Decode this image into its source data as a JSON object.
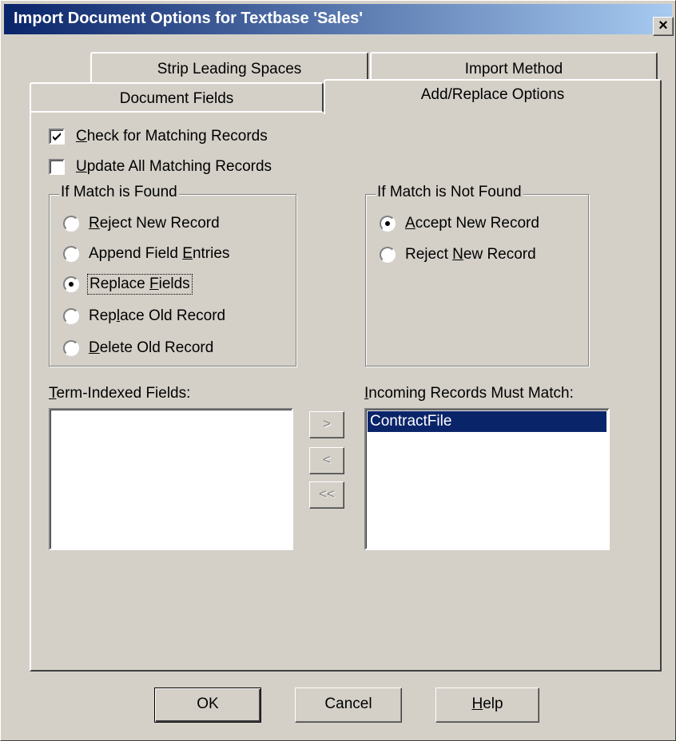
{
  "window": {
    "title": "Import Document Options for Textbase 'Sales'",
    "close_label": "×"
  },
  "tabs": {
    "strip_leading_spaces": "Strip Leading Spaces",
    "import_method": "Import Method",
    "document_fields": "Document Fields",
    "add_replace_options": "Add/Replace Options",
    "active": "Add/Replace Options"
  },
  "checkboxes": {
    "check_matching": {
      "hotkey": "C",
      "rest": "heck for Matching Records",
      "checked": true
    },
    "update_all": {
      "hotkey": "U",
      "rest": "pdate All Matching Records",
      "checked": false
    }
  },
  "if_match_found": {
    "title": "If Match is Found",
    "options": [
      {
        "pre": "",
        "hotkey": "R",
        "post": "eject New Record",
        "selected": false
      },
      {
        "pre": "Append Field ",
        "hotkey": "E",
        "post": "ntries",
        "selected": false
      },
      {
        "pre": "Replace ",
        "hotkey": "F",
        "post": "ields",
        "selected": true
      },
      {
        "pre": "Rep",
        "hotkey": "l",
        "post": "ace Old Record",
        "selected": false
      },
      {
        "pre": "",
        "hotkey": "D",
        "post": "elete Old Record",
        "selected": false
      }
    ]
  },
  "if_match_not_found": {
    "title": "If Match is Not Found",
    "options": [
      {
        "pre": "",
        "hotkey": "A",
        "post": "ccept New Record",
        "selected": true
      },
      {
        "pre": "Reject ",
        "hotkey": "N",
        "post": "ew Record",
        "selected": false
      }
    ]
  },
  "term_indexed": {
    "hotkey": "T",
    "rest": "erm-Indexed Fields:",
    "items": []
  },
  "incoming": {
    "hotkey": "I",
    "rest": "ncoming Records Must Match:",
    "items": [
      "ContractFile"
    ]
  },
  "move_buttons": {
    "add": ">",
    "remove": "<",
    "remove_all": "<<"
  },
  "buttons": {
    "ok": "OK",
    "cancel": "Cancel",
    "help_hotkey": "H",
    "help_rest": "elp"
  }
}
